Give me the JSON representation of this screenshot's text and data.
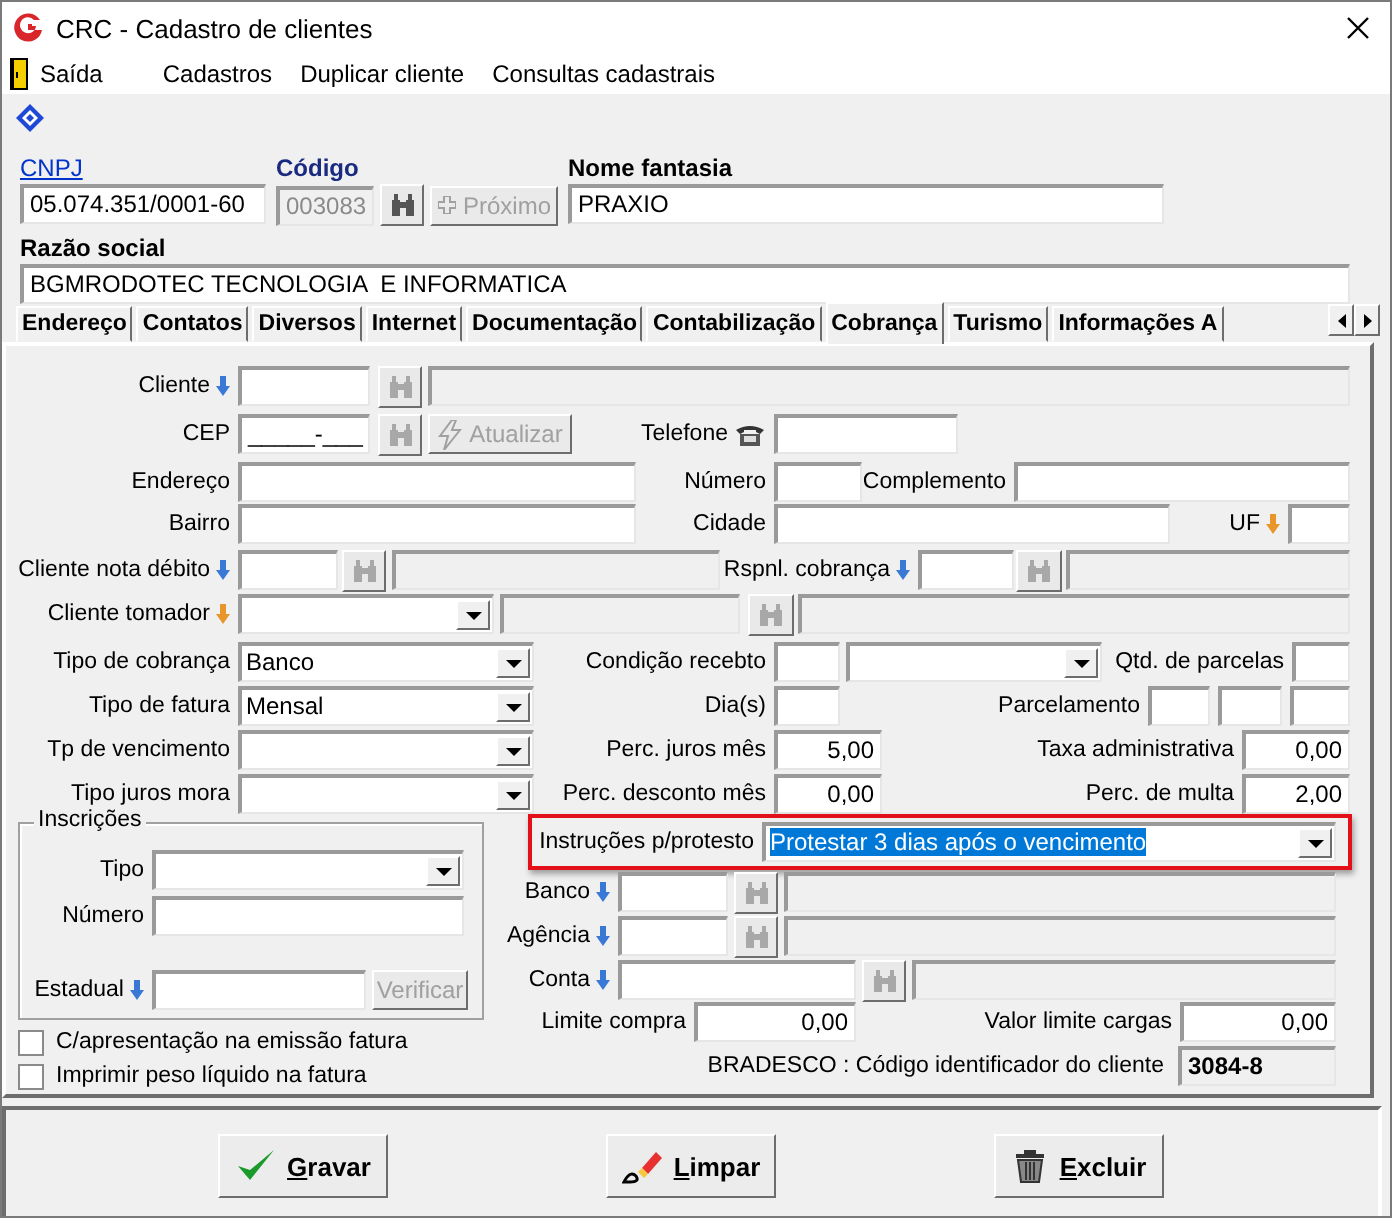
{
  "window": {
    "title": "CRC - Cadastro de clientes"
  },
  "menu": [
    {
      "label": "Saída"
    },
    {
      "label": "Cadastros"
    },
    {
      "label": "Duplicar cliente"
    },
    {
      "label": "Consultas cadastrais"
    }
  ],
  "header": {
    "cnpj": {
      "label": "CNPJ",
      "value": "05.074.351/0001-60"
    },
    "code": {
      "label": "Código",
      "value": "003083",
      "disabled": true
    },
    "search_button": {
      "disabled": false
    },
    "next_button": {
      "label": "Próximo",
      "disabled": true
    },
    "trade_name": {
      "label": "Nome fantasia",
      "value": "PRAXIO"
    },
    "company_name": {
      "label": "Razão social",
      "value": "BGMRODOTEC TECNOLOGIA  E INFORMATICA"
    }
  },
  "tabs": [
    {
      "label": "Endereço",
      "selected": false
    },
    {
      "label": "Contatos",
      "selected": false
    },
    {
      "label": "Diversos",
      "selected": false
    },
    {
      "label": "Internet",
      "selected": false
    },
    {
      "label": "Documentação",
      "selected": false
    },
    {
      "label": "Contabilização",
      "selected": false
    },
    {
      "label": "Cobrança",
      "selected": true
    },
    {
      "label": "Turismo",
      "selected": false
    },
    {
      "label": "Informações A",
      "selected": false
    }
  ],
  "billing": {
    "rows": [
      {
        "items": [
          {
            "kind": "label",
            "text": "Cliente",
            "arrow": {
              "color": "#3a78d6"
            }
          },
          {
            "kind": "field"
          },
          {
            "kind": "lookup",
            "disabled": true
          },
          {
            "kind": "display"
          }
        ]
      },
      {
        "items": [
          {
            "kind": "label",
            "text": "CEP"
          },
          {
            "kind": "field",
            "value": "_____-___"
          },
          {
            "kind": "lookup",
            "disabled": true
          },
          {
            "kind": "button",
            "text": "Atualizar",
            "disabled": true
          },
          {
            "kind": "label",
            "text": "Telefone"
          },
          {
            "kind": "field"
          }
        ]
      },
      {
        "items": [
          {
            "kind": "label",
            "text": "Endereço"
          },
          {
            "kind": "field"
          },
          {
            "kind": "label",
            "text": "Número"
          },
          {
            "kind": "field"
          },
          {
            "kind": "label",
            "text": "Complemento"
          },
          {
            "kind": "field"
          }
        ]
      },
      {
        "items": [
          {
            "kind": "label",
            "text": "Bairro"
          },
          {
            "kind": "field"
          },
          {
            "kind": "label",
            "text": "Cidade"
          },
          {
            "kind": "field"
          },
          {
            "kind": "label",
            "text": "UF",
            "arrow": {
              "color": "#e8962a"
            }
          },
          {
            "kind": "field"
          }
        ]
      },
      {
        "items": [
          {
            "kind": "label",
            "text": "Cliente nota débito",
            "arrow": {
              "color": "#3a78d6"
            }
          },
          {
            "kind": "field"
          },
          {
            "kind": "lookup",
            "disabled": true
          },
          {
            "kind": "display"
          },
          {
            "kind": "label",
            "text": "Rspnl. cobrança",
            "arrow": {
              "color": "#3a78d6"
            }
          },
          {
            "kind": "field"
          },
          {
            "kind": "lookup",
            "disabled": true
          },
          {
            "kind": "display"
          }
        ]
      },
      {
        "items": [
          {
            "kind": "label",
            "text": "Cliente tomador",
            "arrow": {
              "color": "#e8962a"
            }
          },
          {
            "kind": "combo"
          },
          {
            "kind": "display"
          },
          {
            "kind": "lookup",
            "disabled": true
          },
          {
            "kind": "display"
          }
        ]
      },
      {
        "items": [
          {
            "kind": "label",
            "text": "Tipo de cobrança"
          },
          {
            "kind": "combo",
            "value": "Banco"
          },
          {
            "kind": "label",
            "text": "Condição recebto"
          },
          {
            "kind": "field"
          },
          {
            "kind": "combo"
          },
          {
            "kind": "label",
            "text": "Qtd. de parcelas"
          },
          {
            "kind": "field"
          }
        ]
      },
      {
        "items": [
          {
            "kind": "label",
            "text": "Tipo de fatura"
          },
          {
            "kind": "combo",
            "value": "Mensal"
          },
          {
            "kind": "label",
            "text": "Dia(s)"
          },
          {
            "kind": "field"
          },
          {
            "kind": "label",
            "text": "Parcelamento"
          },
          {
            "kind": "field"
          },
          {
            "kind": "field"
          },
          {
            "kind": "field"
          }
        ]
      },
      {
        "items": [
          {
            "kind": "label",
            "text": "Tp de vencimento"
          },
          {
            "kind": "combo"
          },
          {
            "kind": "label",
            "text": "Perc. juros mês"
          },
          {
            "kind": "amount",
            "value": "5,00"
          },
          {
            "kind": "label",
            "text": "Taxa administrativa"
          },
          {
            "kind": "amount",
            "value": "0,00"
          }
        ]
      },
      {
        "items": [
          {
            "kind": "label",
            "text": "Tipo juros mora"
          },
          {
            "kind": "combo"
          },
          {
            "kind": "label",
            "text": "Perc. desconto mês"
          },
          {
            "kind": "amount",
            "value": "0,00"
          },
          {
            "kind": "label",
            "text": "Perc. de multa"
          },
          {
            "kind": "amount",
            "value": "2,00"
          }
        ]
      }
    ],
    "registration": {
      "title": "Inscrições",
      "rows": [
        {
          "items": [
            {
              "kind": "label",
              "text": "Tipo"
            },
            {
              "kind": "combo"
            }
          ]
        },
        {
          "items": [
            {
              "kind": "label",
              "text": "Número"
            },
            {
              "kind": "field"
            }
          ]
        },
        {
          "items": [
            {
              "kind": "label",
              "text": "Estadual",
              "arrow": {
                "color": "#3a78d6"
              }
            },
            {
              "kind": "field"
            },
            {
              "kind": "button",
              "text": "Verificar",
              "disabled": true
            }
          ]
        }
      ]
    },
    "checkboxes": [
      {
        "label": "C/apresentação na emissão fatura",
        "checked": false
      },
      {
        "label": "Imprimir peso líquido na fatura",
        "checked": false
      }
    ],
    "side_rows": [
      {
        "highlighted": true,
        "items": [
          {
            "kind": "label",
            "text": "Instruções p/protesto"
          },
          {
            "kind": "combo",
            "value": "Protestar 3 dias após o vencimento",
            "text_selected": true
          }
        ]
      },
      {
        "highlighted": false,
        "items": [
          {
            "kind": "label",
            "text": "Banco",
            "arrow": {
              "color": "#3a78d6"
            }
          },
          {
            "kind": "field"
          },
          {
            "kind": "lookup",
            "disabled": true
          },
          {
            "kind": "display"
          }
        ]
      },
      {
        "highlighted": false,
        "items": [
          {
            "kind": "label",
            "text": "Agência",
            "arrow": {
              "color": "#3a78d6"
            }
          },
          {
            "kind": "field"
          },
          {
            "kind": "lookup",
            "disabled": true
          },
          {
            "kind": "display"
          }
        ]
      },
      {
        "highlighted": false,
        "items": [
          {
            "kind": "label",
            "text": "Conta",
            "arrow": {
              "color": "#3a78d6"
            }
          },
          {
            "kind": "field"
          },
          {
            "kind": "lookup",
            "disabled": true
          },
          {
            "kind": "display"
          }
        ]
      },
      {
        "highlighted": false,
        "items": [
          {
            "kind": "label",
            "text": "Limite compra"
          },
          {
            "kind": "amount",
            "value": "0,00"
          },
          {
            "kind": "label",
            "text": "Valor limite cargas"
          },
          {
            "kind": "amount",
            "value": "0,00"
          }
        ]
      },
      {
        "highlighted": false,
        "items": [
          {
            "kind": "label",
            "text": "BRADESCO : Código identificador do cliente"
          },
          {
            "kind": "display",
            "value": "3084-8"
          }
        ]
      }
    ]
  },
  "buttons": [
    {
      "label": "Gravar"
    },
    {
      "label": "Limpar"
    },
    {
      "label": "Excluir"
    }
  ]
}
